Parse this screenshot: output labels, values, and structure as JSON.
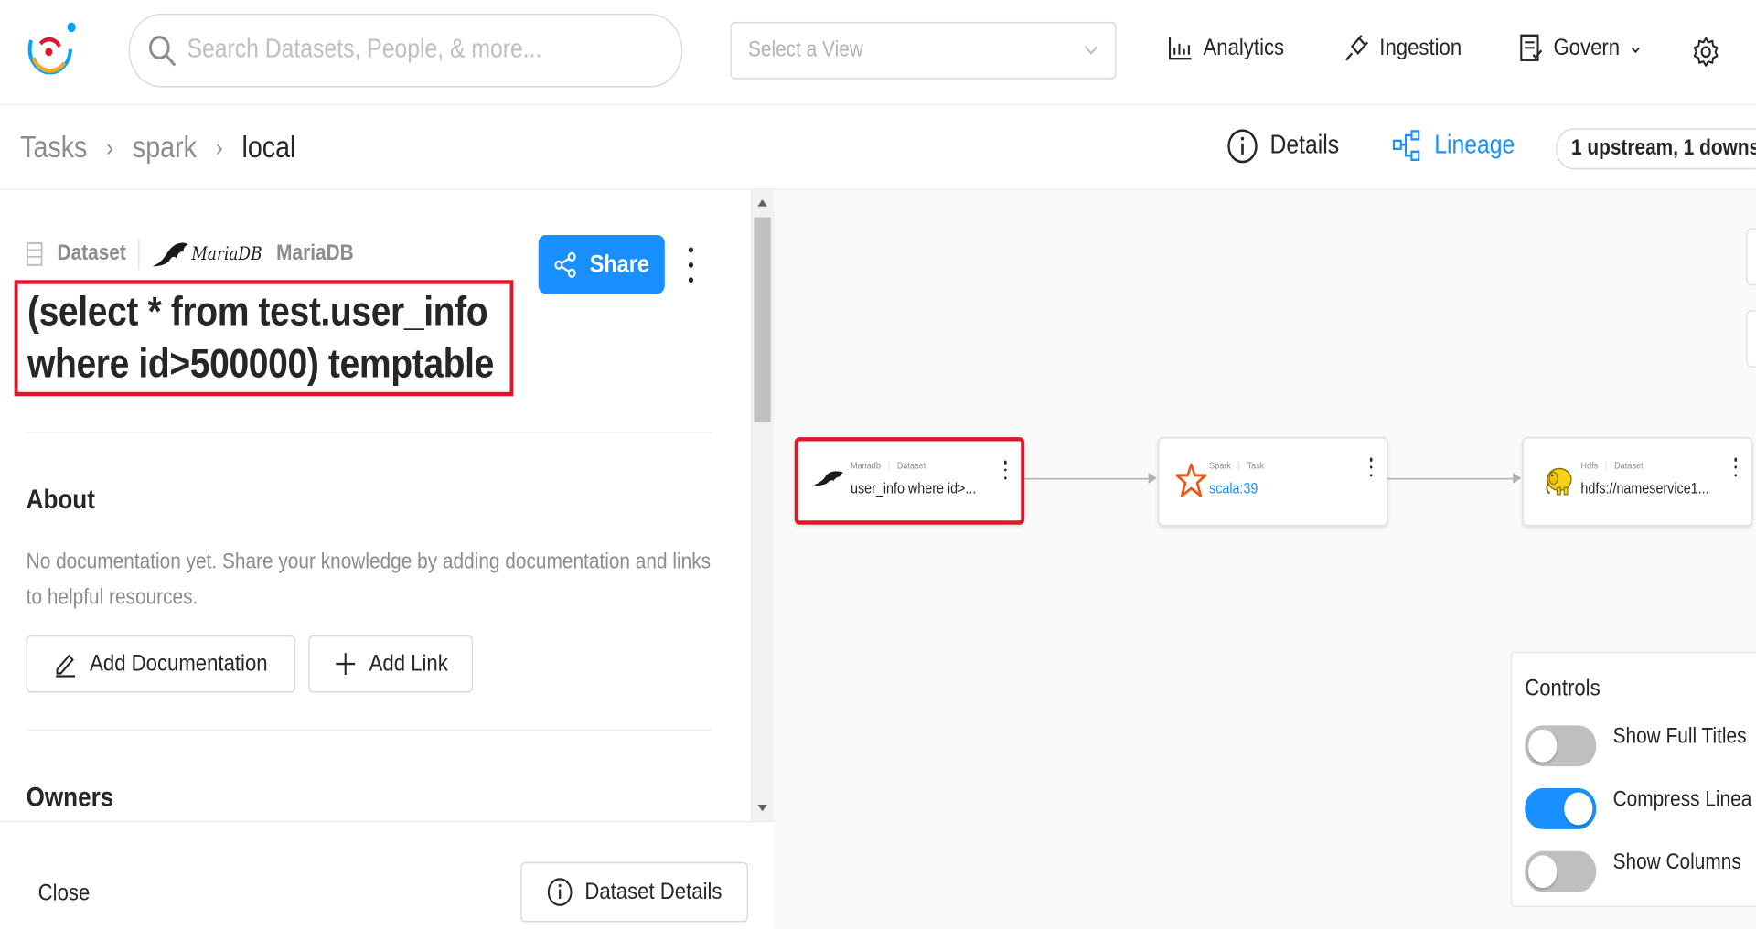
{
  "search": {
    "placeholder": "Search Datasets, People, & more..."
  },
  "view_select": {
    "placeholder": "Select a View"
  },
  "nav": {
    "analytics": "Analytics",
    "ingestion": "Ingestion",
    "govern": "Govern"
  },
  "breadcrumb": {
    "items": [
      "Tasks",
      "spark",
      "local"
    ]
  },
  "tabs": {
    "details": "Details",
    "lineage": "Lineage",
    "updown": "1 upstream, 1 downs"
  },
  "entity": {
    "type": "Dataset",
    "platform_logo_text": "MariaDB",
    "platform": "MariaDB",
    "title": "(select * from test.user_info where id>500000) temptable",
    "share_label": "Share"
  },
  "about": {
    "heading": "About",
    "description": "No documentation yet. Share your knowledge by adding documentation and links to helpful resources.",
    "add_doc": "Add Documentation",
    "add_link": "Add Link"
  },
  "owners": {
    "heading": "Owners"
  },
  "footer": {
    "close": "Close",
    "details_button": "Dataset Details"
  },
  "lineage": {
    "nodes": [
      {
        "platform": "Mariadb",
        "type": "Dataset",
        "name": "user_info where id>...",
        "icon": "mariadb-logo-icon",
        "selected": true
      },
      {
        "platform": "Spark",
        "type": "Task",
        "name": "scala:39",
        "icon": "spark-star-icon",
        "selected": false
      },
      {
        "platform": "Hdfs",
        "type": "Dataset",
        "name": "hdfs://nameservice1...",
        "icon": "hadoop-elephant-icon",
        "selected": false
      }
    ],
    "controls": {
      "heading": "Controls",
      "toggles": [
        {
          "label": "Show Full Titles",
          "on": false
        },
        {
          "label": "Compress Linea",
          "on": true
        },
        {
          "label": "Show Columns",
          "on": false
        }
      ]
    }
  },
  "colors": {
    "accent": "#1890ff",
    "highlight": "#e0162b"
  }
}
